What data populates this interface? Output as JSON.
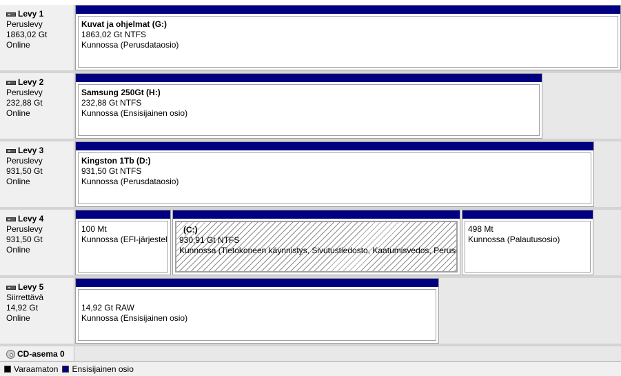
{
  "colors": {
    "primary_partition": "#000080",
    "unallocated": "#000000"
  },
  "disks": [
    {
      "name": "Levy 1",
      "type": "Peruslevy",
      "size": "1863,02 Gt",
      "status": "Online",
      "partitions": [
        {
          "title": "Kuvat ja ohjelmat  (G:)",
          "line1": "1863,02 Gt NTFS",
          "line2": "Kunnossa (Perusdataosio)"
        }
      ]
    },
    {
      "name": "Levy 2",
      "type": "Peruslevy",
      "size": "232,88 Gt",
      "status": "Online",
      "partitions": [
        {
          "title": "Samsung 250Gt  (H:)",
          "line1": "232,88 Gt NTFS",
          "line2": "Kunnossa (Ensisijainen osio)"
        }
      ]
    },
    {
      "name": "Levy 3",
      "type": "Peruslevy",
      "size": "931,50 Gt",
      "status": "Online",
      "partitions": [
        {
          "title": "Kingston 1Tb  (D:)",
          "line1": "931,50 Gt NTFS",
          "line2": "Kunnossa (Perusdataosio)"
        }
      ]
    },
    {
      "name": "Levy 4",
      "type": "Peruslevy",
      "size": "931,50 Gt",
      "status": "Online",
      "partitions": [
        {
          "title": "",
          "line1": "100 Mt",
          "line2": "Kunnossa (EFI-järjestelmäosio)"
        },
        {
          "title": "(C:)",
          "line1": "930,91 Gt NTFS",
          "line2": "Kunnossa (Tietokoneen käynnistys, Sivutustiedosto, Kaatumisvedos, Perusdataosio)"
        },
        {
          "title": "",
          "line1": "498 Mt",
          "line2": "Kunnossa (Palautusosio)"
        }
      ]
    },
    {
      "name": "Levy 5",
      "type": "Siirrettävä",
      "size": "14,92 Gt",
      "status": "Online",
      "partitions": [
        {
          "title": "",
          "line1": "14,92 Gt RAW",
          "line2": "Kunnossa (Ensisijainen osio)"
        }
      ]
    }
  ],
  "cd_drive": {
    "name": "CD-asema 0"
  },
  "legend": [
    {
      "label": "Varaamaton",
      "icon": "black-square"
    },
    {
      "label": "Ensisijainen osio",
      "icon": "navy-square"
    }
  ]
}
